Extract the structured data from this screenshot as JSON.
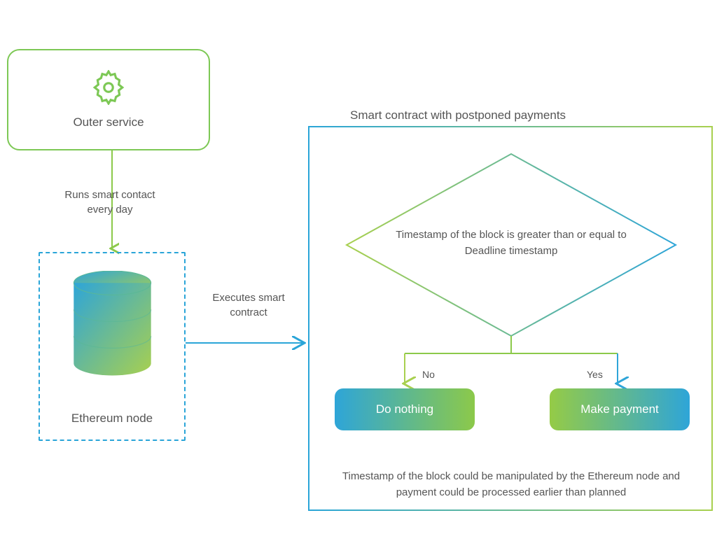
{
  "outer_service": {
    "label": "Outer service"
  },
  "arrow_down": {
    "label": "Runs smart contact every day"
  },
  "ethereum_node": {
    "label": "Ethereum node"
  },
  "arrow_right": {
    "label": "Executes smart contract"
  },
  "smart_contract": {
    "title": "Smart contract with postponed payments"
  },
  "decision": {
    "label": "Timestamp of the block is greater than or equal to Deadline timestamp",
    "no_label": "No",
    "yes_label": "Yes"
  },
  "actions": {
    "do_nothing": "Do nothing",
    "make_payment": "Make payment"
  },
  "footer": {
    "note": "Timestamp of the block could be manipulated by the Ethereum node and payment could be processed earlier than planned"
  }
}
